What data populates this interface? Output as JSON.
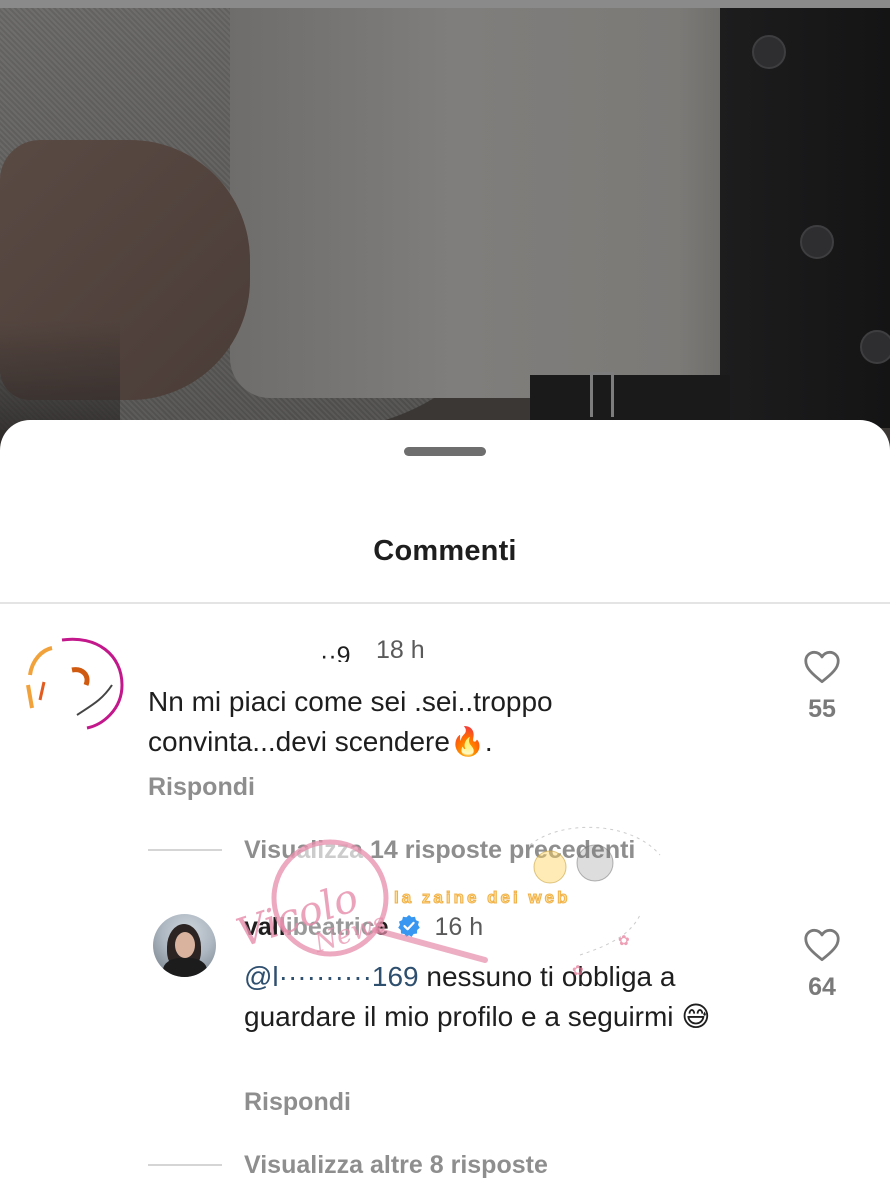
{
  "sheet": {
    "title": "Commenti"
  },
  "comments": [
    {
      "username_visible": "··9",
      "time": "18 h",
      "text": "Nn mi piaci come sei .sei..troppo convinta...devi scendere🔥.",
      "reply_label": "Rispondi",
      "likes": "55",
      "avatar_icon": "scribbled-avatar-icon"
    },
    {
      "username": "vallibeatrice",
      "verified": true,
      "time": "16 h",
      "mention": "@l··········169",
      "text": " nessuno ti obbliga a guardare il mio profilo e a seguirmi 😅",
      "reply_label": "Rispondi",
      "likes": "64",
      "avatar_icon": "profile-photo-avatar"
    }
  ],
  "replies_controls": {
    "previous": "Visualizza 14 risposte precedenti",
    "more": "Visualizza altre 8 risposte"
  },
  "watermark": {
    "stamp_text": "Vicolo delle News",
    "banner_text": "la zaine dei web"
  },
  "colors": {
    "background_dim": "#3b3734",
    "sheet": "#ffffff",
    "text": "#1e1e1e",
    "secondary": "#8e8e8e",
    "verified_blue": "#3897f0"
  }
}
